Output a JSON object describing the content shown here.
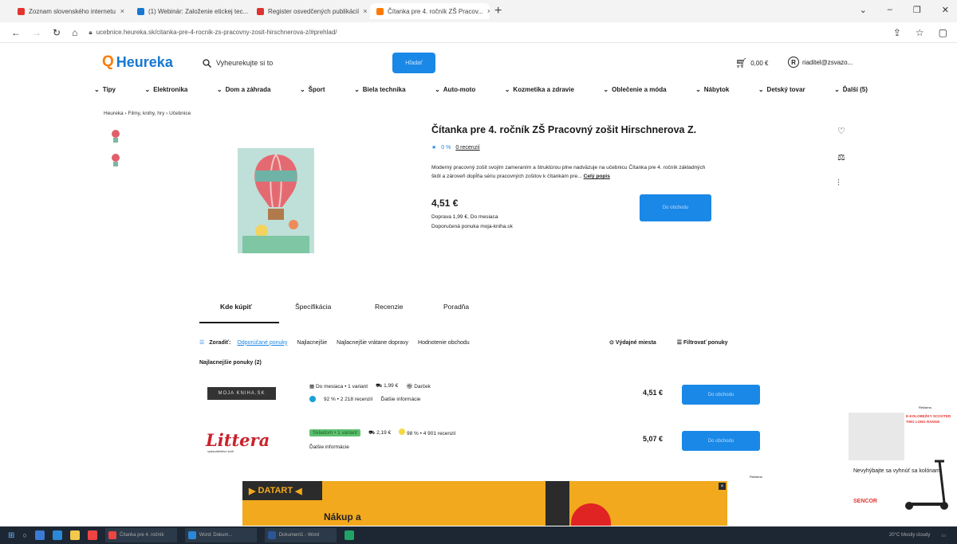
{
  "browser": {
    "tabs": [
      {
        "title": "Zoznam slovenského internetu",
        "color": "#e3342f"
      },
      {
        "title": "(1) Webinár: Založenie etickej tec...",
        "color": "#1678d2"
      },
      {
        "title": "Register osvedčených publikácií",
        "color": "#d33"
      },
      {
        "title": "Čítanka pre 4. ročník ZŠ Pracov...",
        "color": "#ff7a00"
      }
    ],
    "url": "ucebnice.heureka.sk/citanka-pre-4-rocnik-zs-pracovny-zosit-hirschnerova-z/#prehlad/"
  },
  "header": {
    "logo": "Heureka",
    "search_placeholder": "Vyheurekujte si to",
    "search_button": "Hľadať",
    "cart": "0,00 €",
    "user": "riaditel@zsvazo..."
  },
  "categories": [
    "Tipy",
    "Elektronika",
    "Dom a záhrada",
    "Šport",
    "Biela technika",
    "Auto-moto",
    "Kozmetika a zdravie",
    "Oblečenie a móda",
    "Nábytok",
    "Detský tovar",
    "Ďalší (5)"
  ],
  "breadcrumb": "Heureka › Filmy, knihy, hry › Učebnice",
  "product": {
    "title": "Čítanka pre 4. ročník ZŠ Pracovný zošit Hirschnerova Z.",
    "rating_pct": "0 %",
    "reviews": "0 recenzií",
    "desc_1": "Moderný pracovný zošit svojím zameraním a štruktúrou plne nadväzuje na učebnicu Čítanka pre 4. ročník základných",
    "desc_2": "škôl a zároveň dopĺňa sériu pracovných zošitov k čítankám pre...",
    "desc_more": "Celý popis",
    "price": "4,51 €",
    "shipping": "Doprava 1,99 €, Do mesiaca",
    "recommended": "Doporučená ponuka moja-kniha.sk",
    "buy": "Do obchodu"
  },
  "section_tabs": [
    "Kde kúpiť",
    "Špecifikácia",
    "Recenzie",
    "Poradňa"
  ],
  "sort": {
    "label": "Zoradiť:",
    "options": [
      "Odporúčané ponuky",
      "Najlacnejšie",
      "Najlacnejšie vrátane dopravy",
      "Hodnotenie obchodu"
    ],
    "pickup": "Výdajné miesta",
    "filter": "Filtrovať ponuky"
  },
  "offers_title": "Najlacnejšie ponuky (2)",
  "offers": [
    {
      "shop": "MOJA KNIHA.SK",
      "availability": "Do mesiaca • 1 variant",
      "shipping": "1,99 €",
      "gift": "Darček",
      "rating": "92 % • 2 218 recenzií",
      "more": "Ďalšie informácie",
      "price": "4,51 €",
      "button": "Do obchodu",
      "dot_color": "#1a9fd8"
    },
    {
      "shop": "Littera",
      "shop_sub": "vydavateľstvo kníh",
      "availability": "Skladom • 1 variant",
      "shipping": "2,19 €",
      "rating": "98 % • 4 901 recenzií",
      "more": "Ďalšie informácie",
      "price": "5,07 €",
      "button": "Do obchodu",
      "dot_color": "#f5d742"
    }
  ],
  "ad_side": {
    "tag": "Reklama",
    "headline": "E-KOLOBEŽKY SCOOTER TWO LONG RANGE",
    "text": "Nevyhýbajte sa vyhnúť sa kolónam.",
    "brand": "SENCOR"
  },
  "ad_bottom": {
    "tag": "Reklama",
    "brand": "DATART",
    "headline": "Nákup a"
  },
  "taskbar": {
    "apps": [
      "Čítanka pre 4. ročník",
      "Word: Dokum...",
      "Dokument1 - Word"
    ],
    "tray": "20°C  Mostly cloudy"
  }
}
